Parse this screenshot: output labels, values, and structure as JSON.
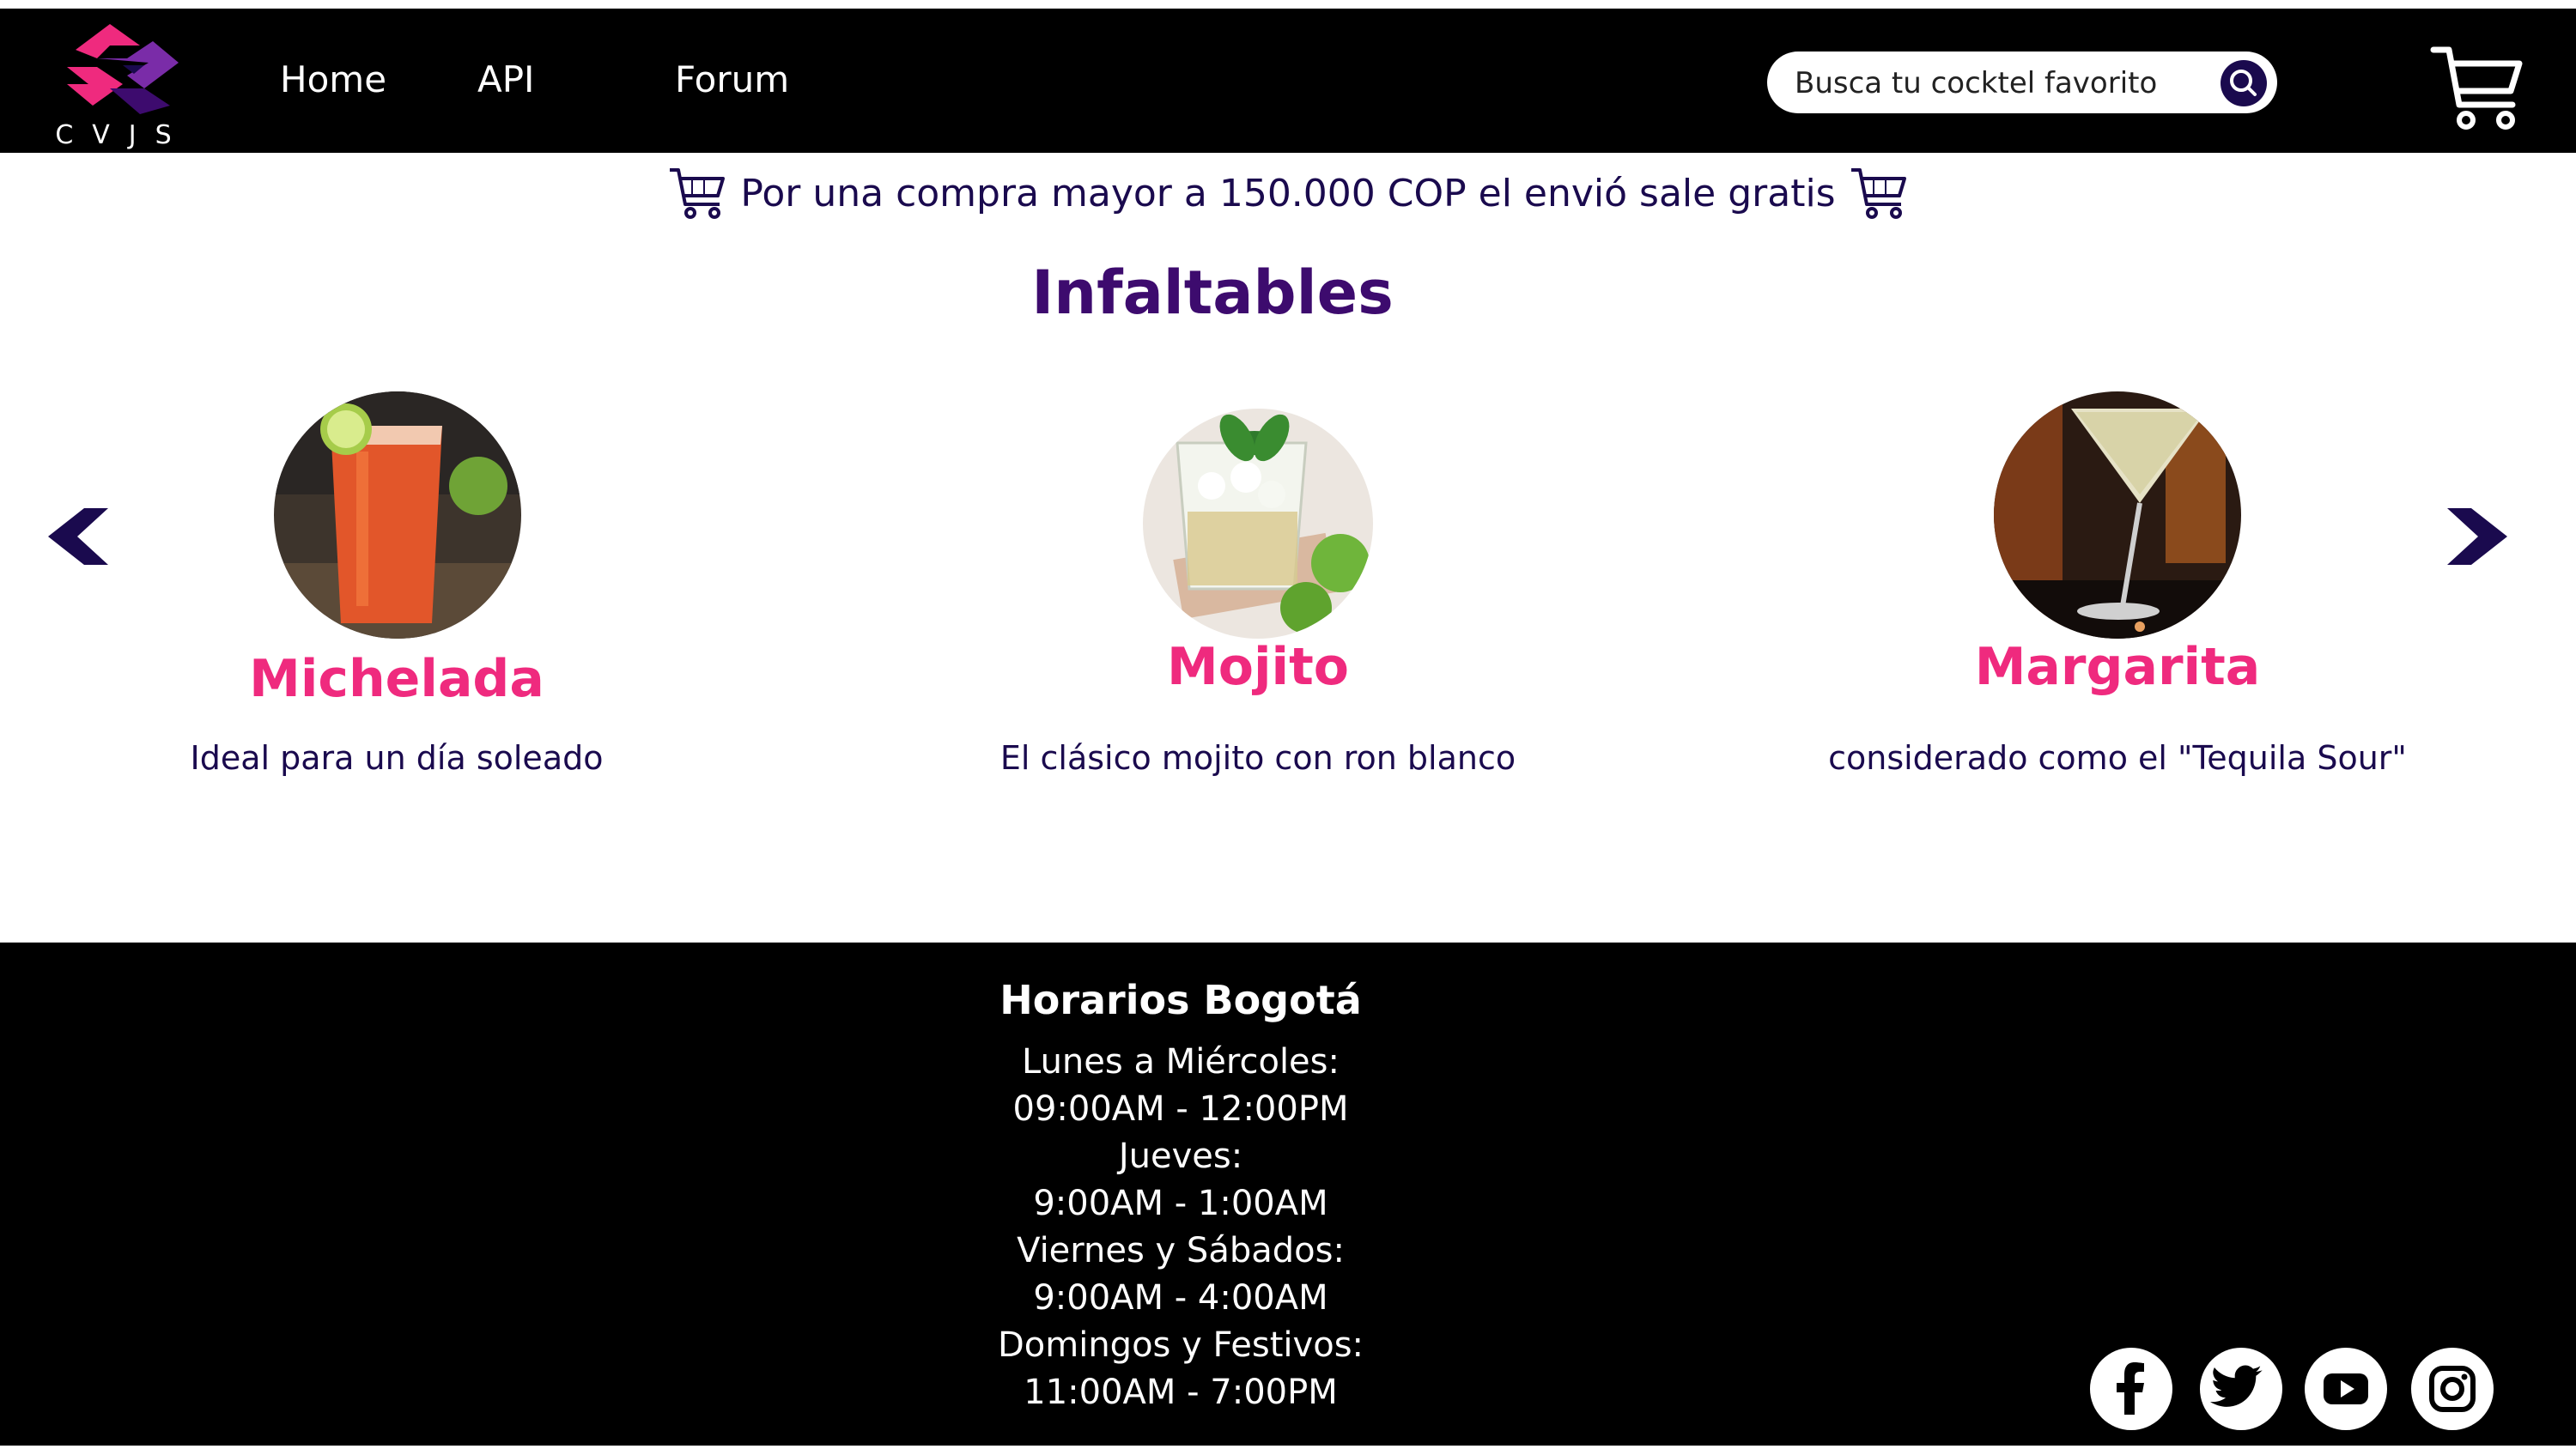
{
  "header": {
    "logo_text": "CVJS",
    "nav": [
      {
        "label": "Home"
      },
      {
        "label": "API"
      },
      {
        "label": "Forum"
      }
    ],
    "search": {
      "placeholder": "Busca tu cocktel favorito"
    }
  },
  "promo": {
    "text": "Por una compra mayor a 150.000 COP el envió sale gratis"
  },
  "section": {
    "title": "Infaltables"
  },
  "cards": [
    {
      "name": "Michelada",
      "description": "Ideal para un día soleado"
    },
    {
      "name": "Mojito",
      "description": "El clásico mojito con ron blanco"
    },
    {
      "name": "Margarita",
      "description": "considerado como el \"Tequila Sour\""
    }
  ],
  "footer": {
    "title": "Horarios Bogotá",
    "hours": [
      "Lunes a Miércoles:",
      "09:00AM - 12:00PM",
      "Jueves:",
      "9:00AM - 1:00AM",
      "Viernes y Sábados:",
      "9:00AM - 4:00AM",
      "Domingos y Festivos:",
      "11:00AM - 7:00PM"
    ],
    "social_icons": [
      "facebook-icon",
      "twitter-icon",
      "youtube-icon",
      "instagram-icon"
    ]
  },
  "colors": {
    "header_bg": "#000000",
    "accent_pink": "#ef2a7e",
    "accent_purple": "#3d0b6e",
    "navy": "#1a0a4e"
  }
}
